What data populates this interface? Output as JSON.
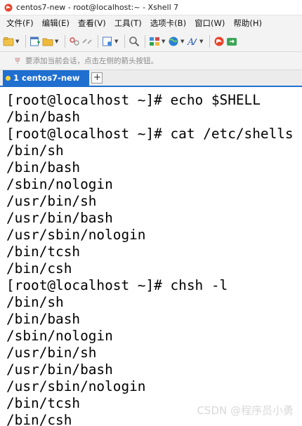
{
  "window": {
    "title": "centos7-new - root@localhost:~ - Xshell 7"
  },
  "menu": [
    {
      "label": "文件(F)"
    },
    {
      "label": "编辑(E)"
    },
    {
      "label": "查看(V)"
    },
    {
      "label": "工具(T)"
    },
    {
      "label": "选项卡(B)"
    },
    {
      "label": "窗口(W)"
    },
    {
      "label": "帮助(H)"
    }
  ],
  "hint": {
    "text": "要添加当前会话，点击左侧的箭头按钮。"
  },
  "tabs": [
    {
      "label": "1 centos7-new"
    }
  ],
  "tab_add_label": "+",
  "terminal": {
    "lines": [
      "[root@localhost ~]# echo $SHELL",
      "/bin/bash",
      "[root@localhost ~]# cat /etc/shells",
      "/bin/sh",
      "/bin/bash",
      "/sbin/nologin",
      "/usr/bin/sh",
      "/usr/bin/bash",
      "/usr/sbin/nologin",
      "/bin/tcsh",
      "/bin/csh",
      "[root@localhost ~]# chsh -l",
      "/bin/sh",
      "/bin/bash",
      "/sbin/nologin",
      "/usr/bin/sh",
      "/usr/bin/bash",
      "/usr/sbin/nologin",
      "/bin/tcsh",
      "/bin/csh"
    ]
  },
  "watermark": {
    "text": "CSDN @程序员小勇"
  },
  "colors": {
    "tab_active": "#1f6fd0",
    "menubar_bg": "#f3f3f3",
    "terminal_bg": "#ffffff",
    "terminal_fg": "#000000"
  },
  "toolbar_icons": [
    "open-folder-icon",
    "new-session-icon",
    "folder-icon",
    "link-icon",
    "unlink-icon",
    "properties-icon",
    "find-icon",
    "layout-icon",
    "globe-icon",
    "font-icon",
    "xshell-icon",
    "xftp-icon"
  ]
}
